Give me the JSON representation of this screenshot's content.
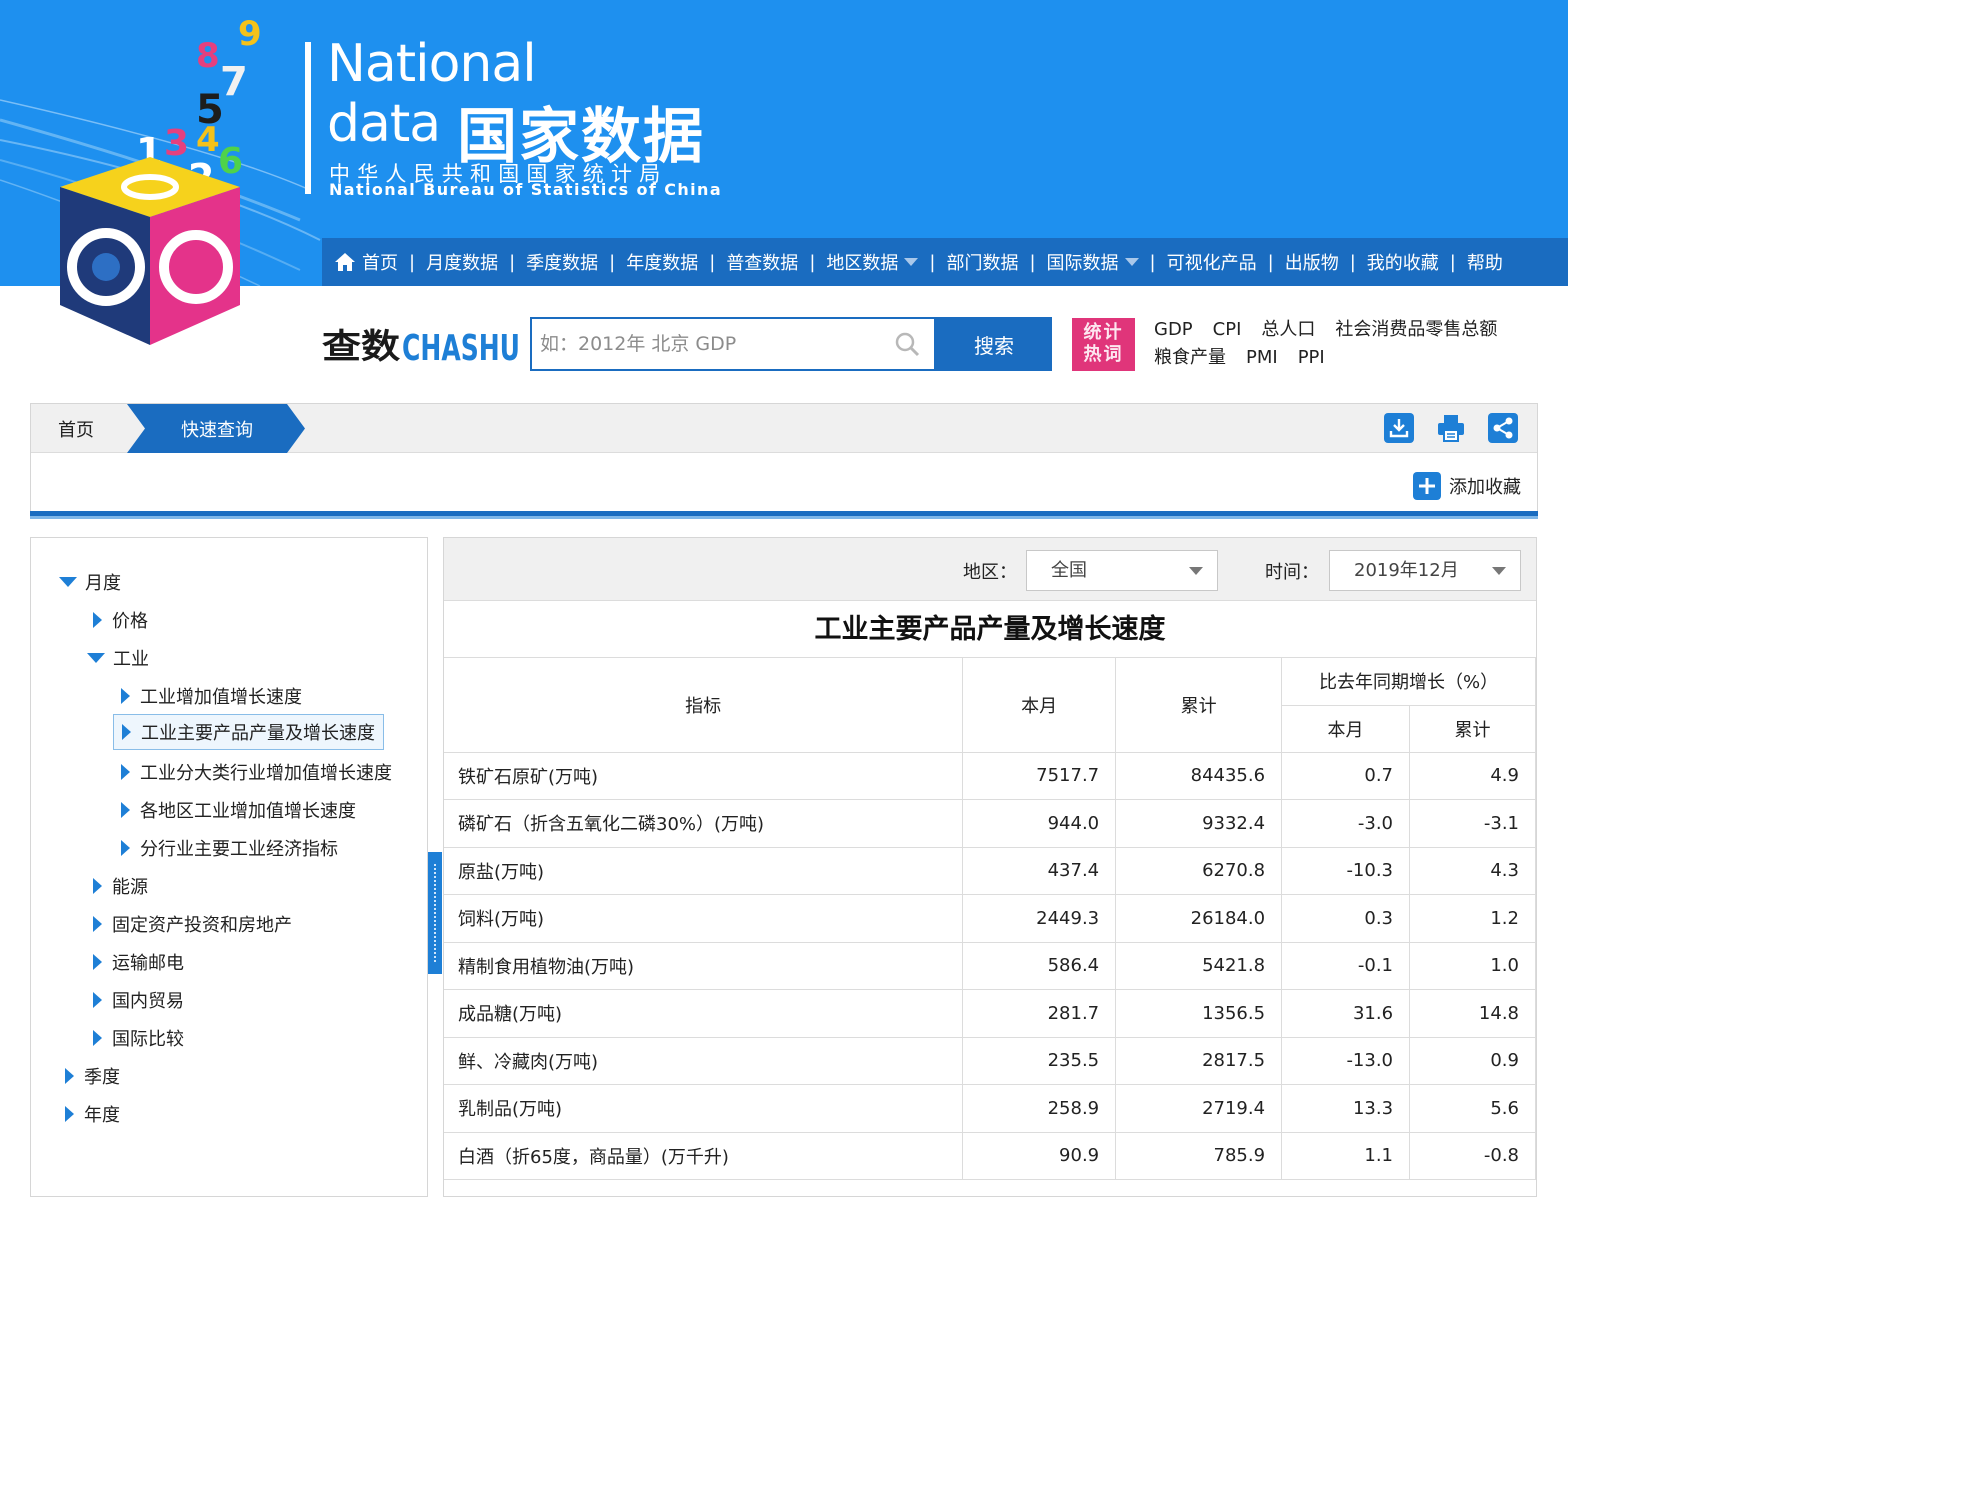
{
  "brand": {
    "line1": "National",
    "line2": "data",
    "cn": "国家数据",
    "sub_cn": "中华人民共和国国家统计局",
    "sub_en": "National Bureau of Statistics of China",
    "cube_numbers": [
      "9",
      "8",
      "7",
      "5",
      "1",
      "3",
      "4",
      "6",
      "2"
    ]
  },
  "nav": {
    "items": [
      {
        "label": "首页",
        "icon": "home-icon"
      },
      {
        "label": "月度数据"
      },
      {
        "label": "季度数据"
      },
      {
        "label": "年度数据"
      },
      {
        "label": "普查数据"
      },
      {
        "label": "地区数据",
        "dropdown": true
      },
      {
        "label": "部门数据"
      },
      {
        "label": "国际数据",
        "dropdown": true
      },
      {
        "label": "可视化产品"
      },
      {
        "label": "出版物"
      },
      {
        "label": "我的收藏"
      },
      {
        "label": "帮助"
      }
    ]
  },
  "search": {
    "logo_cn": "查数",
    "logo_en": "CHASHU",
    "placeholder": "如：2012年 北京 GDP",
    "value": "",
    "button_label": "搜索",
    "hot_badge_line1": "统计",
    "hot_badge_line2": "热词",
    "hot_row1": [
      "GDP",
      "CPI",
      "总人口",
      "社会消费品零售总额"
    ],
    "hot_row2": [
      "粮食产量",
      "PMI",
      "PPI"
    ]
  },
  "breadcrumb": {
    "home": "首页",
    "current": "快速查询",
    "add_favorite": "添加收藏",
    "tools": [
      "download-icon",
      "print-icon",
      "share-icon"
    ]
  },
  "tree": {
    "monthly": "月度",
    "price": "价格",
    "industry": "工业",
    "industry_children": [
      "工业增加值增长速度",
      "工业主要产品产量及增长速度",
      "工业分大类行业增加值增长速度",
      "各地区工业增加值增长速度",
      "分行业主要工业经济指标"
    ],
    "others": [
      "能源",
      "固定资产投资和房地产",
      "运输邮电",
      "国内贸易",
      "国际比较"
    ],
    "quarterly": "季度",
    "yearly": "年度",
    "selected": "工业主要产品产量及增长速度"
  },
  "filters": {
    "region_label": "地区：",
    "region_value": "全国",
    "time_label": "时间：",
    "time_value": "2019年12月"
  },
  "table": {
    "title": "工业主要产品产量及增长速度",
    "col_indicator": "指标",
    "col_month": "本月",
    "col_cumulative": "累计",
    "col_growth_group": "比去年同期增长（%）",
    "col_growth_month": "本月",
    "col_growth_cumulative": "累计",
    "rows": [
      {
        "name": "铁矿石原矿(万吨)",
        "month": "7517.7",
        "cum": "84435.6",
        "g_month": "0.7",
        "g_cum": "4.9"
      },
      {
        "name": "磷矿石（折含五氧化二磷30%）(万吨)",
        "month": "944.0",
        "cum": "9332.4",
        "g_month": "-3.0",
        "g_cum": "-3.1"
      },
      {
        "name": "原盐(万吨)",
        "month": "437.4",
        "cum": "6270.8",
        "g_month": "-10.3",
        "g_cum": "4.3"
      },
      {
        "name": "饲料(万吨)",
        "month": "2449.3",
        "cum": "26184.0",
        "g_month": "0.3",
        "g_cum": "1.2"
      },
      {
        "name": "精制食用植物油(万吨)",
        "month": "586.4",
        "cum": "5421.8",
        "g_month": "-0.1",
        "g_cum": "1.0"
      },
      {
        "name": "成品糖(万吨)",
        "month": "281.7",
        "cum": "1356.5",
        "g_month": "31.6",
        "g_cum": "14.8"
      },
      {
        "name": "鲜、冷藏肉(万吨)",
        "month": "235.5",
        "cum": "2817.5",
        "g_month": "-13.0",
        "g_cum": "0.9"
      },
      {
        "name": "乳制品(万吨)",
        "month": "258.9",
        "cum": "2719.4",
        "g_month": "13.3",
        "g_cum": "5.6"
      },
      {
        "name": "白酒（折65度，商品量）(万千升)",
        "month": "90.9",
        "cum": "785.9",
        "g_month": "1.1",
        "g_cum": "-0.8"
      }
    ]
  },
  "colors": {
    "header_blue": "#1e90ef",
    "nav_blue": "#1a6cc0",
    "accent_blue": "#1e7fd6",
    "hot_pink": "#e0357a"
  }
}
